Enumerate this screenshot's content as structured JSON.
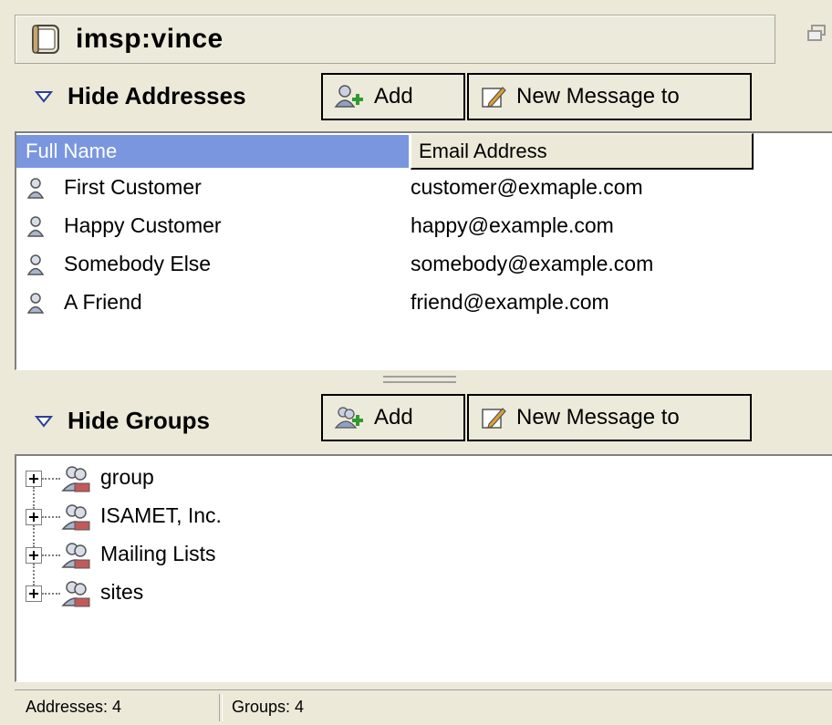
{
  "window": {
    "title": "imsp:vince"
  },
  "addresses": {
    "toggle_label": "Hide Addresses",
    "add_label": "Add",
    "new_message_label": "New Message to",
    "columns": {
      "full_name": "Full Name",
      "email": "Email Address"
    },
    "rows": [
      {
        "name": "First Customer",
        "email": "customer@exmaple.com"
      },
      {
        "name": "Happy Customer",
        "email": "happy@example.com"
      },
      {
        "name": "Somebody Else",
        "email": "somebody@example.com"
      },
      {
        "name": "A Friend",
        "email": "friend@example.com"
      }
    ]
  },
  "groups": {
    "toggle_label": "Hide Groups",
    "add_label": "Add",
    "new_message_label": "New Message to",
    "items": [
      "group",
      "ISAMET, Inc.",
      "Mailing Lists",
      "sites"
    ]
  },
  "status": {
    "addresses": "Addresses:  4",
    "groups": "Groups: 4"
  },
  "icons": {
    "window": "address-book-icon",
    "restore": "restore-window-icon",
    "toggle": "collapse-triangle-icon",
    "add": "add-contact-icon",
    "new_message": "compose-icon",
    "contact": "person-icon",
    "group": "group-icon",
    "expander": "plus-expander-icon"
  },
  "colors": {
    "selected_header": "#7a96df",
    "background": "#ece9d8",
    "panel": "#ffffff"
  }
}
